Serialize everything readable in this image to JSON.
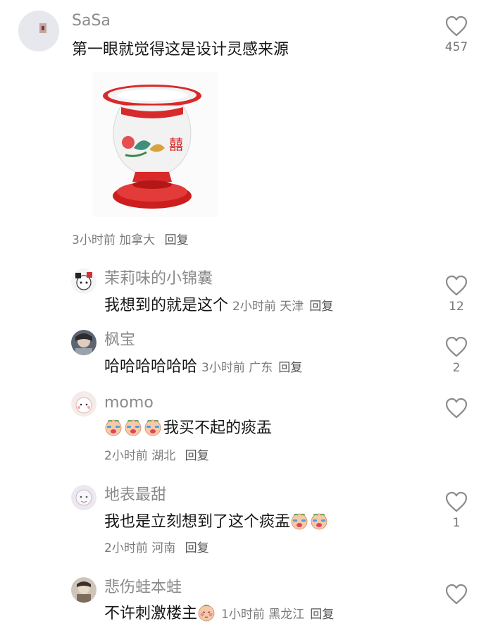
{
  "colors": {
    "name": "#8a8a8a",
    "text": "#161616",
    "meta": "#7a7a7a",
    "heart": "#8c8c8c"
  },
  "comments": [
    {
      "user": "SaSa",
      "text": "第一眼就觉得这是设计灵感来源",
      "image": "spittoon-photo",
      "time": "3小时前",
      "location": "加拿大",
      "reply": "回复",
      "likes": "457"
    }
  ],
  "replies": [
    {
      "user": "茉莉味的小锦囊",
      "text": "我想到的就是这个",
      "time": "2小时前",
      "location": "天津",
      "reply": "回复",
      "likes": "12"
    },
    {
      "user": "枫宝",
      "text": "哈哈哈哈哈哈",
      "time": "3小时前",
      "location": "广东",
      "reply": "回复",
      "likes": "2"
    },
    {
      "user": "momo",
      "text": "我买不起的痰盂",
      "emoji": [
        "crying-face-emoji",
        "crying-face-emoji",
        "crying-face-emoji"
      ],
      "time": "2小时前",
      "location": "湖北",
      "reply": "回复",
      "likes": ""
    },
    {
      "user": "地表最甜",
      "text": "我也是立刻想到了这个痰盂",
      "emoji": [
        "crying-face-emoji",
        "crying-face-emoji"
      ],
      "time": "2小时前",
      "location": "河南",
      "reply": "回复",
      "likes": "1"
    },
    {
      "user": "悲伤蛙本蛙",
      "text": "不许刺激楼主",
      "emoji": [
        "blushing-face-emoji"
      ],
      "time": "1小时前",
      "location": "黑龙江",
      "reply": "回复",
      "likes": ""
    }
  ]
}
